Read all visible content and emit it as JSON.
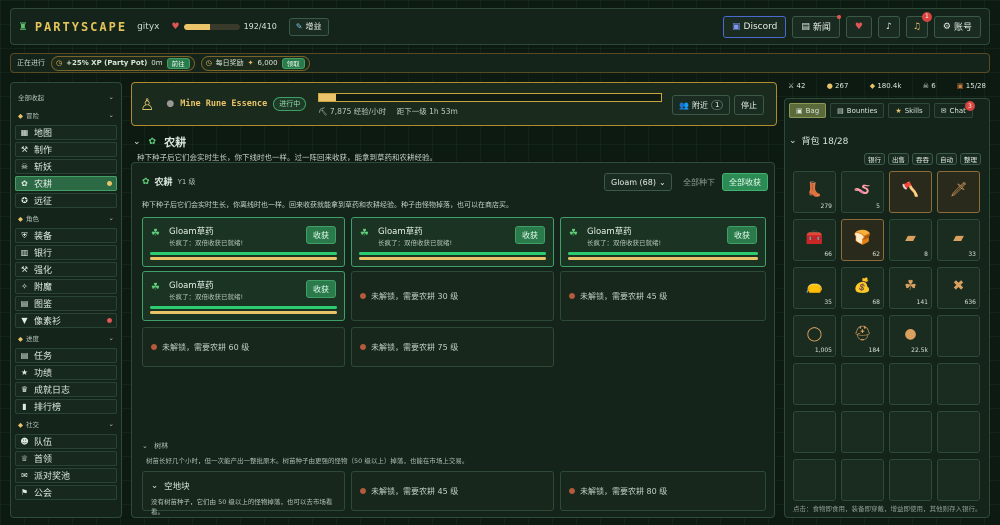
{
  "app": {
    "title": "PARTYSCAPE",
    "username": "gityx",
    "hp": "192/410",
    "hp_fraction": 0.47,
    "boost_label": "增益"
  },
  "topnav": {
    "discord": "Discord",
    "news": "新闻",
    "account": "账号",
    "notif_count": "1"
  },
  "event": {
    "label": "正在进行",
    "xp_text": "+25% XP (Party Pot)",
    "xp_time": "0m",
    "xp_btn": "前往",
    "daily_text": "每日奖励",
    "daily_amount": "6,000",
    "daily_btn": "领取"
  },
  "sidebar": {
    "collapse_all": "全部收起",
    "sections": [
      {
        "title": "冒险",
        "items": [
          "地图",
          "制作",
          "斩妖",
          "农耕",
          "远征"
        ]
      },
      {
        "title": "角色",
        "items": [
          "装备",
          "银行",
          "强化",
          "附魔",
          "图鉴",
          "像素衫"
        ]
      },
      {
        "title": "进度",
        "items": [
          "任务",
          "功绩",
          "成就日志",
          "排行榜"
        ]
      },
      {
        "title": "社交",
        "items": [
          "队伍",
          "首领",
          "派对奖池",
          "公会"
        ]
      }
    ]
  },
  "task": {
    "name": "Mine Rune Essence",
    "status": "进行中",
    "progress": 0.05,
    "rate": "7,875 经验/小时",
    "next_level": "距下一级 1h 53m",
    "nearby": "附近",
    "nearby_count": "1",
    "stop": "停止"
  },
  "farming": {
    "title": "农耕",
    "desc": "种下种子后它们会实时生长，你下线时也一样。过一阵回来收获，能拿到草药和农耕经验。",
    "panel_title": "农耕",
    "level": "Y1 级",
    "seed_select": "Gloam (68)",
    "plant_all": "全部种下",
    "harvest_all": "全部收获",
    "panel_desc": "种下种子后它们会实时生长，你离线时也一样。回来收获就能拿到草药和农耕经验。种子由怪物掉落，也可以在商店买。",
    "plots": [
      {
        "name": "Gloam草药",
        "sub": "长疯了：双倍收获已就绪!",
        "btn": "收获"
      },
      {
        "name": "Gloam草药",
        "sub": "长疯了：双倍收获已就绪!",
        "btn": "收获"
      },
      {
        "name": "Gloam草药",
        "sub": "长疯了：双倍收获已就绪!",
        "btn": "收获"
      },
      {
        "name": "Gloam草药",
        "sub": "长疯了：双倍收获已就绪!",
        "btn": "收获"
      }
    ],
    "locked": [
      "未解锁，需要农耕 30 级",
      "未解锁，需要农耕 45 级",
      "未解锁，需要农耕 60 级",
      "未解锁，需要农耕 75 级"
    ],
    "tree_title": "树林",
    "tree_desc": "树苗长好几个小时，但一次能产出一整批原木。树苗种子由更强的怪物（50 级以上）掉落，也能在市场上交易。",
    "empty_title": "空地块",
    "empty_desc": "没有树苗种子，它们由 50 级以上的怪物掉落，也可以去市场看看。",
    "tree_locked": [
      "未解锁，需要农耕 45 级",
      "未解锁，需要农耕 80 级"
    ]
  },
  "stats": [
    "42",
    "267",
    "180.4k",
    "6",
    "15/28"
  ],
  "inventory": {
    "tabs": [
      "Bag",
      "Bounties",
      "Skills",
      "Chat"
    ],
    "chat_badge": "3",
    "title": "背包 18/28",
    "actions": [
      "银行",
      "出售",
      "吞吞",
      "自动",
      "整理"
    ],
    "items": [
      {
        "icon": "boot-icon",
        "glyph": "👢",
        "qty": "279"
      },
      {
        "icon": "worm-icon",
        "glyph": "🪱",
        "qty": "5"
      },
      {
        "icon": "axe-icon",
        "glyph": "🪓",
        "qty": ""
      },
      {
        "icon": "sword-icon",
        "glyph": "🗡",
        "qty": ""
      },
      {
        "icon": "chest-icon",
        "glyph": "🧰",
        "qty": "66"
      },
      {
        "icon": "bread-icon",
        "glyph": "🍞",
        "qty": "62"
      },
      {
        "icon": "bar-icon",
        "glyph": "▰",
        "qty": "8"
      },
      {
        "icon": "ingot-icon",
        "glyph": "▰",
        "qty": "33"
      },
      {
        "icon": "pouch-icon",
        "glyph": "👝",
        "qty": "35"
      },
      {
        "icon": "sack-icon",
        "glyph": "💰",
        "qty": "68"
      },
      {
        "icon": "herb-icon",
        "glyph": "☘",
        "qty": "141"
      },
      {
        "icon": "bones-icon",
        "glyph": "✖",
        "qty": "636"
      },
      {
        "icon": "ring-icon",
        "glyph": "◯",
        "qty": "1,005"
      },
      {
        "icon": "helmet-icon",
        "glyph": "⛑",
        "qty": "184"
      },
      {
        "icon": "rock-icon",
        "glyph": "●",
        "qty": "22.5k"
      }
    ],
    "footer": "点击：食物即食用，装备即穿戴，增益即使用，其他则存入银行。"
  }
}
